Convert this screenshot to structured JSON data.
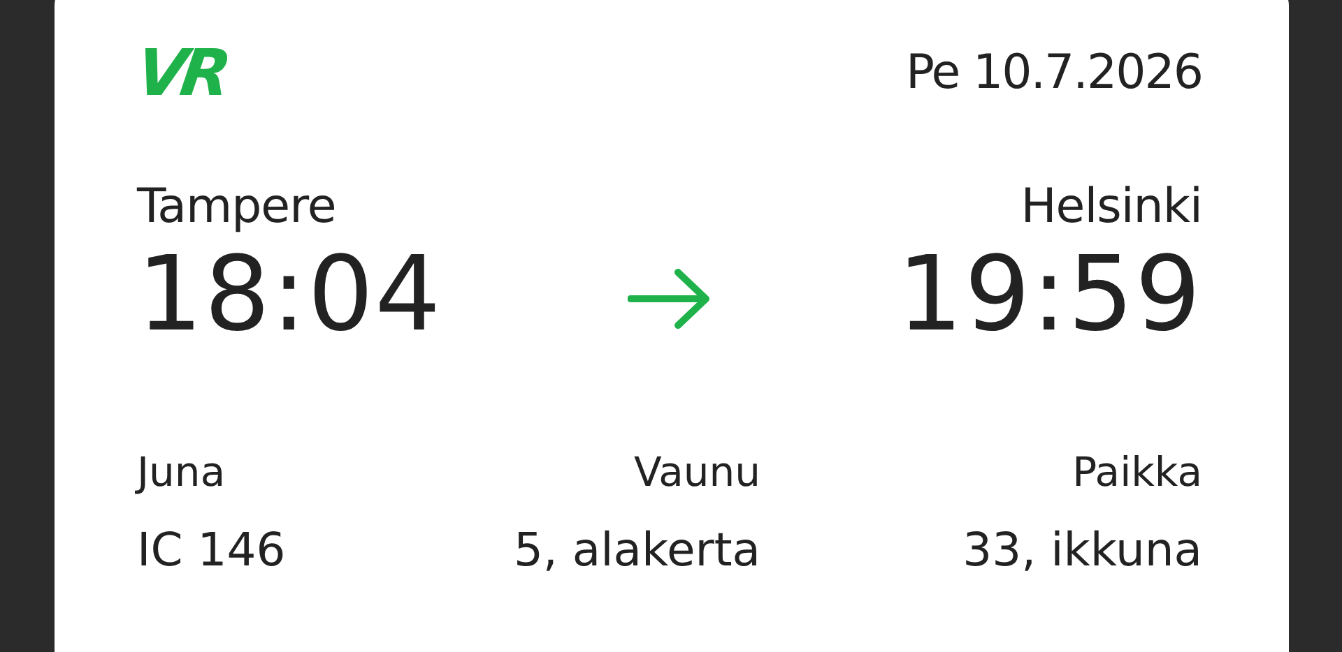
{
  "logo": "VR",
  "date": "Pe 10.7.2026",
  "from": {
    "station": "Tampere",
    "time": "18:04"
  },
  "to": {
    "station": "Helsinki",
    "time": "19:59"
  },
  "details": [
    {
      "label": "Juna",
      "value": "IC 146"
    },
    {
      "label": "Vaunu",
      "value": "5, alakerta"
    },
    {
      "label": "Paikka",
      "value": "33, ikkuna"
    }
  ]
}
